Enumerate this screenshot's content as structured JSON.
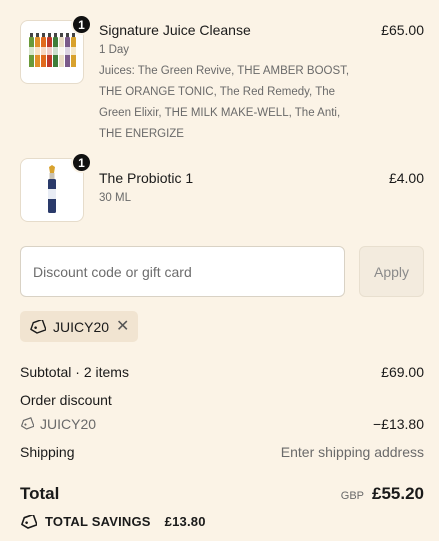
{
  "line_items": [
    {
      "quantity": "1",
      "title": "Signature Juice Cleanse",
      "variant": "1 Day",
      "details": [
        "Juices: The Green Revive, THE AMBER BOOST,",
        "THE ORANGE TONIC, The Red Remedy, The",
        "Green Elixir, THE MILK MAKE-WELL, The Anti,",
        "THE ENERGIZE"
      ],
      "price": "£65.00"
    },
    {
      "quantity": "1",
      "title": "The Probiotic 1",
      "variant": "30 ML",
      "price": "£4.00"
    }
  ],
  "discount": {
    "placeholder": "Discount code or gift card",
    "value": "",
    "apply_label": "Apply",
    "applied_code": "JUICY20"
  },
  "summary": {
    "subtotal_label": "Subtotal · 2 items",
    "subtotal_value": "£69.00",
    "order_discount_label": "Order discount",
    "discount_code": "JUICY20",
    "discount_value": "−£13.80",
    "shipping_label": "Shipping",
    "shipping_value": "Enter shipping address",
    "total_label": "Total",
    "currency": "GBP",
    "total_value": "£55.20",
    "savings_label": "TOTAL SAVINGS",
    "savings_value": "£13.80"
  },
  "colors": {
    "background": "#fbf3e6",
    "chip": "#f1e4d1",
    "badge": "#111111",
    "bottles": [
      "#6a9a3a",
      "#e2902a",
      "#e06a1e",
      "#c0392b",
      "#3e7d3a",
      "#e9dcc5",
      "#7a5a8a",
      "#d8a22e"
    ]
  }
}
